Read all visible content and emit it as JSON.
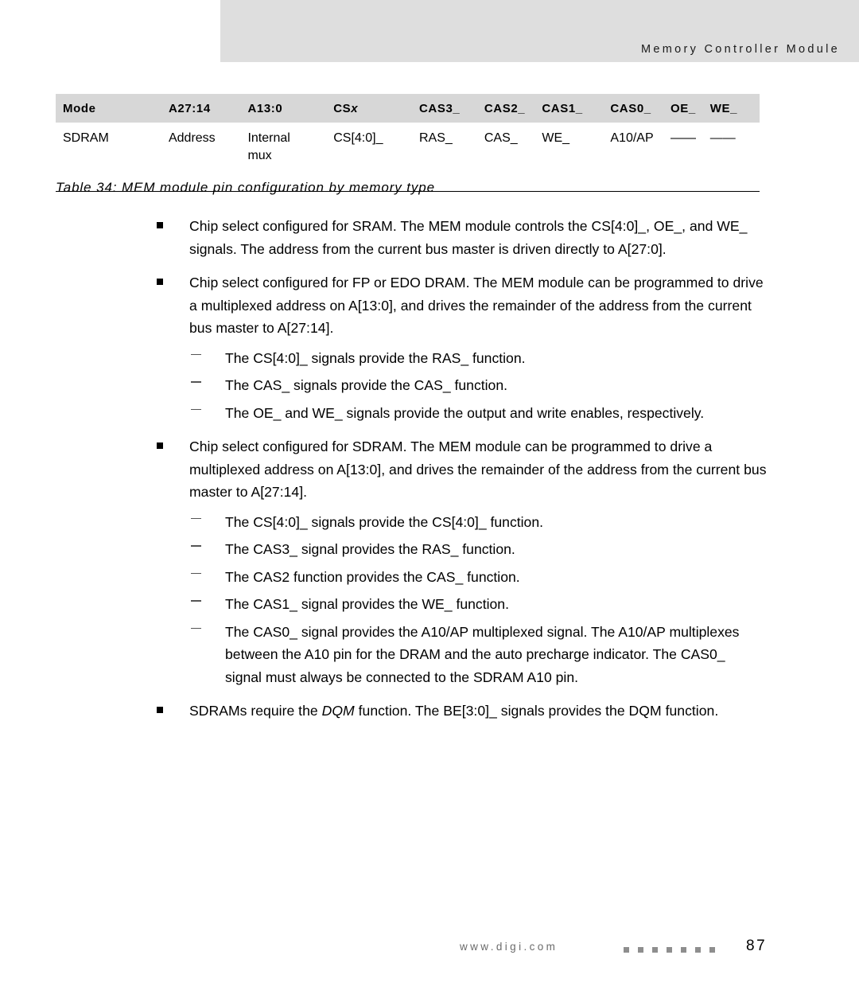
{
  "header": {
    "title": "Memory Controller Module"
  },
  "table": {
    "columns": [
      {
        "key": "mode",
        "label": "Mode"
      },
      {
        "key": "a2714",
        "label": "A27:14"
      },
      {
        "key": "a130",
        "label": "A13:0"
      },
      {
        "key": "csx",
        "label": "CS",
        "label_italic_suffix": "x"
      },
      {
        "key": "cas3",
        "label": "CAS3_"
      },
      {
        "key": "cas2",
        "label": "CAS2_"
      },
      {
        "key": "cas1",
        "label": "CAS1_"
      },
      {
        "key": "cas0",
        "label": "CAS0_"
      },
      {
        "key": "oe",
        "label": "OE_"
      },
      {
        "key": "we",
        "label": "WE_"
      }
    ],
    "rows": [
      {
        "mode": "SDRAM",
        "a2714": "Address",
        "a130_line1": "Internal",
        "a130_line2": "mux",
        "csx": "CS[4:0]_",
        "cas3": "RAS_",
        "cas2": "CAS_",
        "cas1": "WE_",
        "cas0": "A10/AP",
        "oe": "——",
        "we": "——"
      }
    ],
    "caption": "Table 34: MEM module pin configuration by memory type"
  },
  "body": {
    "bullet_sram": "Chip select configured for SRAM. The MEM module controls the CS[4:0]_, OE_, and WE_ signals. The address from the current bus master is driven directly to A[27:0].",
    "bullet_fp_edo": "Chip select configured for FP or EDO DRAM. The MEM module can be programmed to drive a multiplexed address on A[13:0], and drives the remainder of the address from the current bus master to A[27:14].",
    "sub_fp_edo": [
      "The CS[4:0]_ signals provide the RAS_ function.",
      "The CAS_ signals provide the CAS_ function.",
      "The OE_ and WE_ signals provide the output and write enables, respectively."
    ],
    "bullet_sdram": "Chip select configured for SDRAM. The MEM module can be programmed to drive a multiplexed address on A[13:0], and drives the remainder of the address from the current bus master to A[27:14].",
    "sub_sdram": [
      "The CS[4:0]_ signals provide the CS[4:0]_ function.",
      "The CAS3_ signal provides the RAS_ function.",
      "The CAS2 function provides the CAS_ function.",
      "The CAS1_ signal provides the WE_ function.",
      "The CAS0_ signal provides the A10/AP multiplexed signal. The A10/AP multiplexes between the A10 pin for the DRAM and the auto precharge indicator. The CAS0_ signal must always be connected to the SDRAM A10 pin."
    ],
    "bullet_dqm_pre": "SDRAMs require the ",
    "bullet_dqm_em": "DQM",
    "bullet_dqm_post": " function. The BE[3:0]_ signals provides the DQM function."
  },
  "footer": {
    "url": "www.digi.com",
    "page": "87",
    "dot_count": 7
  },
  "colors": {
    "header_band": "#dedede",
    "table_header": "#d7d7d7",
    "footer_text": "#6b6b6b",
    "footer_dot": "#8e8e8e"
  }
}
